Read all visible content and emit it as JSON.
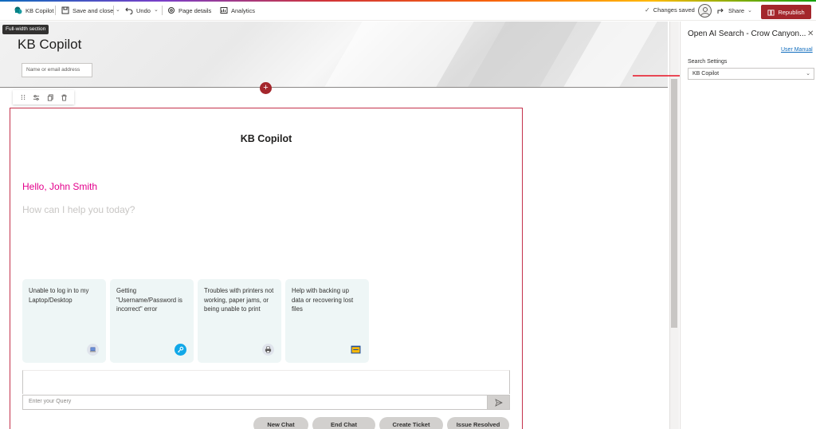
{
  "commandbar": {
    "site_name": "KB Copilot",
    "save_close": "Save and close",
    "undo": "Undo",
    "page_details": "Page details",
    "analytics": "Analytics",
    "changes_saved": "Changes saved",
    "share": "Share",
    "republish": "Republish"
  },
  "hero": {
    "section_tag": "Full-width section",
    "title": "KB Copilot",
    "input_placeholder": "Name or email address"
  },
  "webpart": {
    "title": "KB Copilot",
    "greeting": "Hello, John Smith",
    "prompt": "How can I help you today?",
    "cards": [
      {
        "text": "Unable to log in to my Laptop/Desktop",
        "icon": "laptop-icon"
      },
      {
        "text": "Getting \"Username/Password is incorrect\" error",
        "icon": "key-icon"
      },
      {
        "text": "Troubles with printers not working, paper jams, or being unable to print",
        "icon": "printer-icon"
      },
      {
        "text": "Help with backing up data or recovering lost files",
        "icon": "backup-folder-icon"
      }
    ],
    "query_placeholder": "Enter your Query",
    "buttons": {
      "new_chat": "New Chat",
      "end_chat": "End Chat",
      "create_ticket": "Create Ticket",
      "issue_resolved": "Issue Resolved"
    }
  },
  "panel": {
    "title": "Open AI Search - Crow Canyon...",
    "user_manual": "User Manual",
    "search_settings_label": "Search Settings",
    "search_settings_value": "KB Copilot"
  },
  "colors": {
    "accent": "#a4262c",
    "greeting": "#e3008c",
    "card_bg": "#eef6f6",
    "link": "#0f6cbd"
  }
}
